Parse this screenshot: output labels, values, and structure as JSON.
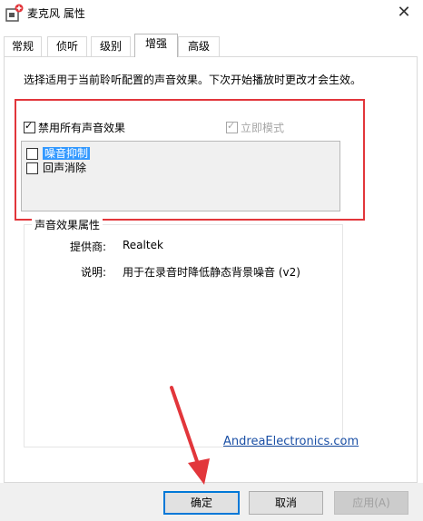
{
  "window": {
    "title": "麦克风 属性",
    "close_label": "✕"
  },
  "tabs": [
    {
      "label": "常规"
    },
    {
      "label": "侦听"
    },
    {
      "label": "级别"
    },
    {
      "label": "增强"
    },
    {
      "label": "高级"
    }
  ],
  "active_tab": "增强",
  "enhancements": {
    "description": "选择适用于当前聆听配置的声音效果。下次开始播放时更改才会生效。",
    "disable_all_label": "禁用所有声音效果",
    "disable_all_checked": true,
    "immediate_mode_label": "立即模式",
    "immediate_mode_checked": true,
    "immediate_mode_enabled": false,
    "effects": [
      {
        "label": "噪音抑制",
        "checked": false,
        "selected": true
      },
      {
        "label": "回声消除",
        "checked": false,
        "selected": false
      }
    ]
  },
  "properties": {
    "group_title": "声音效果属性",
    "provider_label": "提供商:",
    "provider_value": "Realtek",
    "description_label": "说明:",
    "description_value": "用于在录音时降低静态背景噪音 (v2)",
    "vendor_link": "AndreaElectronics.com"
  },
  "buttons": {
    "ok": "确定",
    "cancel": "取消",
    "apply": "应用(A)"
  },
  "colors": {
    "highlight_box": "#e2363b",
    "selection": "#3399ff",
    "link": "#1a4fa5",
    "annotation_arrow": "#e2363b"
  }
}
